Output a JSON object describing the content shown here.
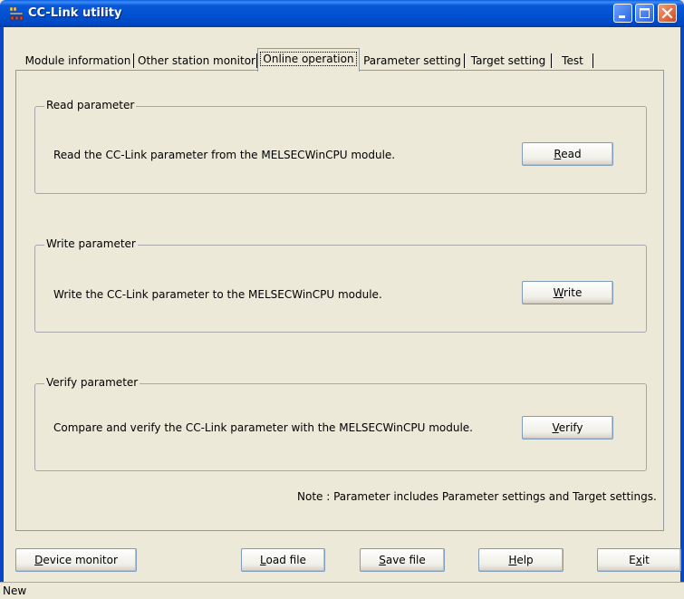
{
  "window": {
    "title": "CC-Link utility"
  },
  "tabs": [
    {
      "label": "Module information",
      "active": false
    },
    {
      "label": "Other station monitor",
      "active": false
    },
    {
      "label": "Online operation",
      "active": true
    },
    {
      "label": "Parameter setting",
      "active": false
    },
    {
      "label": "Target setting",
      "active": false
    },
    {
      "label": "Test",
      "active": false
    }
  ],
  "groups": {
    "read": {
      "title": "Read parameter",
      "description": "Read the CC-Link parameter from the MELSECWinCPU module.",
      "button_accel": "R",
      "button_rest": "ead"
    },
    "write": {
      "title": "Write parameter",
      "description": "Write the CC-Link parameter to the MELSECWinCPU module.",
      "button_accel": "W",
      "button_rest": "rite"
    },
    "verify": {
      "title": "Verify parameter",
      "description": "Compare and verify the CC-Link parameter with the MELSECWinCPU module.",
      "button_accel": "V",
      "button_rest": "erify"
    }
  },
  "note": "Note : Parameter includes Parameter settings and Target settings.",
  "footer": {
    "device_monitor": {
      "accel": "D",
      "rest": "evice monitor"
    },
    "load_file": {
      "accel": "L",
      "rest": "oad file"
    },
    "save_file": {
      "accel": "S",
      "rest": "ave file"
    },
    "help": {
      "accel": "H",
      "rest": "elp"
    },
    "exit": {
      "pre": "E",
      "accel": "x",
      "rest": "it"
    }
  },
  "status_bar": {
    "text": "New"
  },
  "colors": {
    "titlebar": "#0050d0",
    "face": "#ece9d8",
    "close_button": "#d24a1e"
  }
}
